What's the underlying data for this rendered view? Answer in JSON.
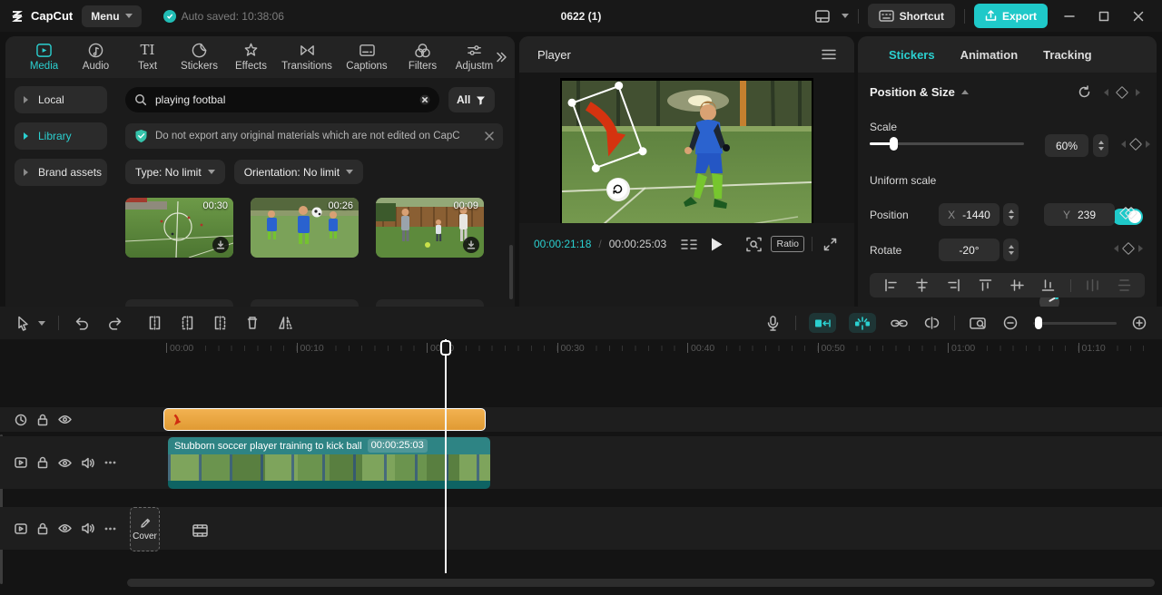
{
  "titlebar": {
    "logo_text": "CapCut",
    "menu_label": "Menu",
    "autosave_text": "Auto saved: 10:38:06",
    "project_title": "0622 (1)",
    "shortcut_label": "Shortcut",
    "export_label": "Export"
  },
  "media_panel": {
    "tabs": [
      {
        "label": "Media",
        "active": true
      },
      {
        "label": "Audio"
      },
      {
        "label": "Text"
      },
      {
        "label": "Stickers"
      },
      {
        "label": "Effects"
      },
      {
        "label": "Transitions"
      },
      {
        "label": "Captions"
      },
      {
        "label": "Filters"
      },
      {
        "label": "Adjustm"
      }
    ],
    "sources": [
      {
        "label": "Local"
      },
      {
        "label": "Library",
        "active": true
      },
      {
        "label": "Brand assets"
      }
    ],
    "search": {
      "value": "playing footbal",
      "filter_label": "All"
    },
    "notice_text": "Do not export any original materials which are not edited on CapC",
    "type_filter": "Type: No limit",
    "orientation_filter": "Orientation: No limit",
    "thumbnails": [
      {
        "duration": "00:30",
        "download": true
      },
      {
        "duration": "00:26",
        "download": false
      },
      {
        "duration": "00:09",
        "download": true
      }
    ]
  },
  "player": {
    "title": "Player",
    "current_time": "00:00:21:18",
    "time_separator": "/",
    "total_time": "00:00:25:03",
    "ratio_label": "Ratio"
  },
  "inspector": {
    "tabs": [
      {
        "label": "Stickers",
        "active": true
      },
      {
        "label": "Animation"
      },
      {
        "label": "Tracking"
      }
    ],
    "section_title": "Position & Size",
    "scale": {
      "label": "Scale",
      "value": "60%"
    },
    "uniform": {
      "label": "Uniform scale",
      "on": true
    },
    "position": {
      "label": "Position",
      "x_label": "X",
      "x_value": "-1440",
      "y_label": "Y",
      "y_value": "239"
    },
    "rotate": {
      "label": "Rotate",
      "value": "-20°"
    }
  },
  "timeline": {
    "ruler": [
      "00:00",
      "00:10",
      "00:20",
      "00:30",
      "00:40",
      "00:50",
      "01:00",
      "01:10"
    ],
    "video_clip": {
      "title": "Stubborn soccer player training to kick ball",
      "duration": "00:00:25:03"
    },
    "cover_label": "Cover"
  },
  "icons": {
    "text_tab_glyph": "TI"
  },
  "colors": {
    "accent_teal": "#1fc9c9",
    "sticker_orange": "#e9a63e",
    "video_clip_teal": "#2e8484",
    "current_time_teal": "#2bd0d0"
  }
}
